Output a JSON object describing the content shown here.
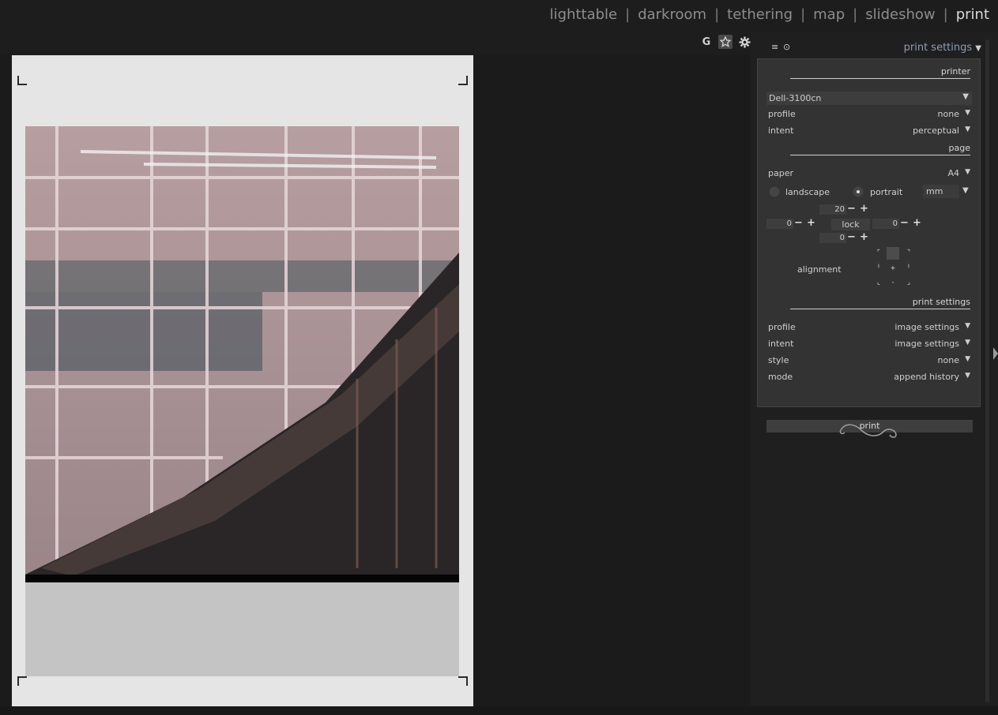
{
  "topbar": {
    "views": [
      {
        "label": "lighttable",
        "active": false
      },
      {
        "label": "darkroom",
        "active": false
      },
      {
        "label": "tethering",
        "active": false
      },
      {
        "label": "map",
        "active": false
      },
      {
        "label": "slideshow",
        "active": false
      },
      {
        "label": "print",
        "active": true
      }
    ],
    "separator": "|"
  },
  "toolbar": {
    "grouping_label": "G",
    "overlay_icon": "star-icon",
    "prefs_icon": "gear-icon"
  },
  "right_panel": {
    "header_icons": [
      "≡",
      "⊙"
    ],
    "title": "print settings",
    "title_arrow": "▼",
    "printer_section": {
      "title": "printer",
      "printer_value": "Dell-3100cn",
      "profile_label": "profile",
      "profile_value": "none",
      "intent_label": "intent",
      "intent_value": "perceptual"
    },
    "page_section": {
      "title": "page",
      "paper_label": "paper",
      "paper_value": "A4",
      "landscape_label": "landscape",
      "portrait_label": "portrait",
      "orientation": "portrait",
      "unit_value": "mm",
      "margin_top": "20",
      "margin_left": "0",
      "margin_right": "0",
      "margin_bottom": "0",
      "lock_label": "lock",
      "alignment_label": "alignment"
    },
    "print_section": {
      "title": "print settings",
      "profile_label": "profile",
      "profile_value": "image settings",
      "intent_label": "intent",
      "intent_value": "image settings",
      "style_label": "style",
      "style_value": "none",
      "mode_label": "mode",
      "mode_value": "append history",
      "print_button": "print"
    }
  },
  "colors": {
    "accent_title": "#8f9bb8",
    "panel_bg": "#333333",
    "paper_bg": "#e5e5e5"
  }
}
